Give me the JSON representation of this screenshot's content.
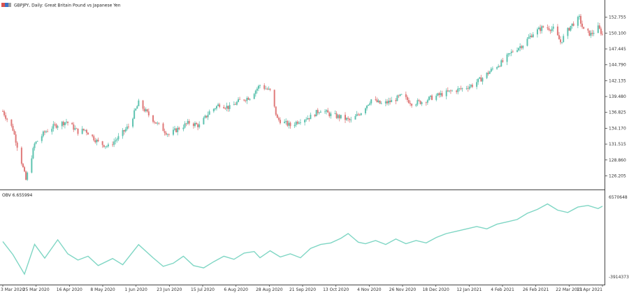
{
  "colors": {
    "bull": "#5fc3b0",
    "bear": "#e07a7a",
    "obv_line": "#7fd6c4",
    "frame": "#444444",
    "background": "#ffffff"
  },
  "header": {
    "icon": "symbol-icon",
    "title": "GBPJPY, Daily: Great Britain Pound vs Japanese Yen"
  },
  "price_axis": {
    "labels": [
      "152.755",
      "150.100",
      "147.445",
      "144.790",
      "142.135",
      "139.480",
      "136.825",
      "134.170",
      "131.515",
      "128.860",
      "126.205"
    ]
  },
  "indicator": {
    "label": "OBV 6.655994",
    "axis_labels": [
      "6570648",
      "-3914373"
    ]
  },
  "time_axis": {
    "labels": [
      "3 Mar 2020",
      "25 Mar 2020",
      "16 Apr 2020",
      "8 May 2020",
      "1 Jun 2020",
      "23 Jun 2020",
      "15 Jul 2020",
      "6 Aug 2020",
      "28 Aug 2020",
      "21 Sep 2020",
      "13 Oct 2020",
      "4 Nov 2020",
      "26 Nov 2020",
      "18 Dec 2020",
      "12 Jan 2021",
      "4 Feb 2021",
      "26 Feb 2021",
      "22 Mar 2021",
      "13 Apr 2021"
    ]
  },
  "chart_data": {
    "type": "candlestick",
    "symbol": "GBPJPY",
    "timeframe": "Daily",
    "description": "Great Britain Pound vs Japanese Yen",
    "ylim": [
      124.5,
      154.0
    ],
    "x_range": [
      "2020-03-03",
      "2021-04-22"
    ],
    "close_path": [
      {
        "date": "2020-03-03",
        "close": 137.0
      },
      {
        "date": "2020-03-10",
        "close": 134.0
      },
      {
        "date": "2020-03-16",
        "close": 128.5
      },
      {
        "date": "2020-03-19",
        "close": 125.5
      },
      {
        "date": "2020-03-25",
        "close": 131.5
      },
      {
        "date": "2020-04-01",
        "close": 133.5
      },
      {
        "date": "2020-04-08",
        "close": 134.6
      },
      {
        "date": "2020-04-16",
        "close": 135.3
      },
      {
        "date": "2020-04-24",
        "close": 133.6
      },
      {
        "date": "2020-04-29",
        "close": 133.9
      },
      {
        "date": "2020-05-08",
        "close": 131.8
      },
      {
        "date": "2020-05-15",
        "close": 131.1
      },
      {
        "date": "2020-05-22",
        "close": 132.6
      },
      {
        "date": "2020-05-29",
        "close": 134.5
      },
      {
        "date": "2020-06-05",
        "close": 138.4
      },
      {
        "date": "2020-06-12",
        "close": 136.4
      },
      {
        "date": "2020-06-19",
        "close": 134.6
      },
      {
        "date": "2020-06-26",
        "close": 133.1
      },
      {
        "date": "2020-07-03",
        "close": 134.2
      },
      {
        "date": "2020-07-10",
        "close": 135.1
      },
      {
        "date": "2020-07-17",
        "close": 134.6
      },
      {
        "date": "2020-07-24",
        "close": 136.9
      },
      {
        "date": "2020-07-31",
        "close": 138.2
      },
      {
        "date": "2020-08-07",
        "close": 137.6
      },
      {
        "date": "2020-08-14",
        "close": 138.8
      },
      {
        "date": "2020-08-21",
        "close": 139.4
      },
      {
        "date": "2020-08-28",
        "close": 141.4
      },
      {
        "date": "2020-09-04",
        "close": 140.4
      },
      {
        "date": "2020-09-09",
        "close": 135.7
      },
      {
        "date": "2020-09-18",
        "close": 134.6
      },
      {
        "date": "2020-09-25",
        "close": 135.6
      },
      {
        "date": "2020-10-02",
        "close": 136.1
      },
      {
        "date": "2020-10-09",
        "close": 137.3
      },
      {
        "date": "2020-10-16",
        "close": 136.4
      },
      {
        "date": "2020-10-23",
        "close": 136.0
      },
      {
        "date": "2020-10-30",
        "close": 135.4
      },
      {
        "date": "2020-11-06",
        "close": 136.9
      },
      {
        "date": "2020-11-13",
        "close": 139.0
      },
      {
        "date": "2020-11-20",
        "close": 138.2
      },
      {
        "date": "2020-11-27",
        "close": 138.7
      },
      {
        "date": "2020-12-04",
        "close": 139.6
      },
      {
        "date": "2020-12-11",
        "close": 138.4
      },
      {
        "date": "2020-12-18",
        "close": 138.6
      },
      {
        "date": "2020-12-25",
        "close": 139.3
      },
      {
        "date": "2021-01-01",
        "close": 139.9
      },
      {
        "date": "2021-01-08",
        "close": 140.4
      },
      {
        "date": "2021-01-15",
        "close": 140.8
      },
      {
        "date": "2021-01-22",
        "close": 141.4
      },
      {
        "date": "2021-01-29",
        "close": 142.6
      },
      {
        "date": "2021-02-05",
        "close": 144.1
      },
      {
        "date": "2021-02-12",
        "close": 145.3
      },
      {
        "date": "2021-02-19",
        "close": 147.1
      },
      {
        "date": "2021-02-26",
        "close": 148.2
      },
      {
        "date": "2021-03-05",
        "close": 150.1
      },
      {
        "date": "2021-03-12",
        "close": 151.1
      },
      {
        "date": "2021-03-19",
        "close": 150.8
      },
      {
        "date": "2021-03-24",
        "close": 148.6
      },
      {
        "date": "2021-03-31",
        "close": 151.3
      },
      {
        "date": "2021-04-06",
        "close": 152.6
      },
      {
        "date": "2021-04-09",
        "close": 150.5
      },
      {
        "date": "2021-04-14",
        "close": 149.9
      },
      {
        "date": "2021-04-19",
        "close": 151.0
      },
      {
        "date": "2021-04-22",
        "close": 149.9
      }
    ],
    "indicator_series": {
      "name": "OBV",
      "ylim": [
        -3914373,
        6570648
      ],
      "points": [
        {
          "date": "2020-03-03",
          "value": 980000
        },
        {
          "date": "2020-03-10",
          "value": -700000
        },
        {
          "date": "2020-03-18",
          "value": -3200000
        },
        {
          "date": "2020-03-25",
          "value": 620000
        },
        {
          "date": "2020-04-01",
          "value": -1150000
        },
        {
          "date": "2020-04-10",
          "value": 1200000
        },
        {
          "date": "2020-04-17",
          "value": -600000
        },
        {
          "date": "2020-04-24",
          "value": -1400000
        },
        {
          "date": "2020-05-01",
          "value": -900000
        },
        {
          "date": "2020-05-08",
          "value": -2100000
        },
        {
          "date": "2020-05-18",
          "value": -1200000
        },
        {
          "date": "2020-05-25",
          "value": -2000000
        },
        {
          "date": "2020-06-05",
          "value": 580000
        },
        {
          "date": "2020-06-15",
          "value": -1100000
        },
        {
          "date": "2020-06-22",
          "value": -2200000
        },
        {
          "date": "2020-06-29",
          "value": -1800000
        },
        {
          "date": "2020-07-06",
          "value": -900000
        },
        {
          "date": "2020-07-13",
          "value": -2100000
        },
        {
          "date": "2020-07-20",
          "value": -2400000
        },
        {
          "date": "2020-07-27",
          "value": -1600000
        },
        {
          "date": "2020-08-03",
          "value": -900000
        },
        {
          "date": "2020-08-10",
          "value": -1300000
        },
        {
          "date": "2020-08-17",
          "value": -500000
        },
        {
          "date": "2020-08-24",
          "value": -300000
        },
        {
          "date": "2020-08-28",
          "value": -1100000
        },
        {
          "date": "2020-09-04",
          "value": -200000
        },
        {
          "date": "2020-09-11",
          "value": -1000000
        },
        {
          "date": "2020-09-18",
          "value": -600000
        },
        {
          "date": "2020-09-25",
          "value": -1100000
        },
        {
          "date": "2020-10-02",
          "value": 100000
        },
        {
          "date": "2020-10-09",
          "value": 600000
        },
        {
          "date": "2020-10-16",
          "value": 800000
        },
        {
          "date": "2020-10-23",
          "value": 1400000
        },
        {
          "date": "2020-10-28",
          "value": 2000000
        },
        {
          "date": "2020-11-04",
          "value": 900000
        },
        {
          "date": "2020-11-09",
          "value": 700000
        },
        {
          "date": "2020-11-16",
          "value": 1100000
        },
        {
          "date": "2020-11-23",
          "value": 600000
        },
        {
          "date": "2020-11-30",
          "value": 1300000
        },
        {
          "date": "2020-12-07",
          "value": 700000
        },
        {
          "date": "2020-12-14",
          "value": 1100000
        },
        {
          "date": "2020-12-21",
          "value": 800000
        },
        {
          "date": "2020-12-28",
          "value": 1500000
        },
        {
          "date": "2021-01-04",
          "value": 2000000
        },
        {
          "date": "2021-01-11",
          "value": 2300000
        },
        {
          "date": "2021-01-18",
          "value": 2600000
        },
        {
          "date": "2021-01-25",
          "value": 2900000
        },
        {
          "date": "2021-02-01",
          "value": 2600000
        },
        {
          "date": "2021-02-08",
          "value": 3200000
        },
        {
          "date": "2021-02-15",
          "value": 3500000
        },
        {
          "date": "2021-02-22",
          "value": 3800000
        },
        {
          "date": "2021-03-01",
          "value": 4600000
        },
        {
          "date": "2021-03-08",
          "value": 5100000
        },
        {
          "date": "2021-03-15",
          "value": 5800000
        },
        {
          "date": "2021-03-22",
          "value": 5000000
        },
        {
          "date": "2021-03-29",
          "value": 4700000
        },
        {
          "date": "2021-04-05",
          "value": 5400000
        },
        {
          "date": "2021-04-12",
          "value": 5600000
        },
        {
          "date": "2021-04-19",
          "value": 5200000
        },
        {
          "date": "2021-04-22",
          "value": 5500000
        }
      ]
    }
  }
}
